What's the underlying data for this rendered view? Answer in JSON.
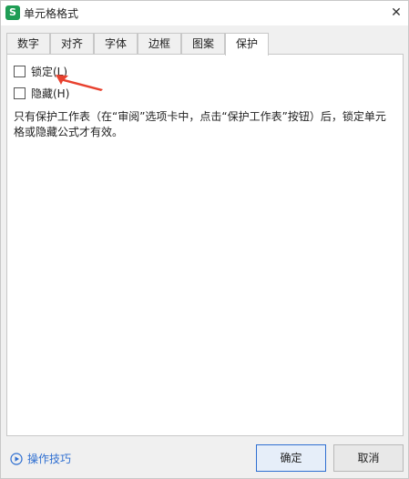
{
  "window": {
    "title": "单元格格式",
    "app_icon_letter": "S",
    "close_glyph": "✕"
  },
  "tabs": [
    {
      "label": "数字",
      "active": false
    },
    {
      "label": "对齐",
      "active": false
    },
    {
      "label": "字体",
      "active": false
    },
    {
      "label": "边框",
      "active": false
    },
    {
      "label": "图案",
      "active": false
    },
    {
      "label": "保护",
      "active": true
    }
  ],
  "protection": {
    "locked_label": "锁定(L)",
    "locked_checked": false,
    "hidden_label": "隐藏(H)",
    "hidden_checked": false,
    "description": "只有保护工作表（在“审阅”选项卡中，点击“保护工作表”按钮）后，锁定单元格或隐藏公式才有效。"
  },
  "annotation": {
    "arrow_color": "#e8412e"
  },
  "footer": {
    "tips_label": "操作技巧",
    "ok_label": "确定",
    "cancel_label": "取消"
  },
  "colors": {
    "accent": "#2f6fd1",
    "app_icon": "#1f9d55"
  }
}
